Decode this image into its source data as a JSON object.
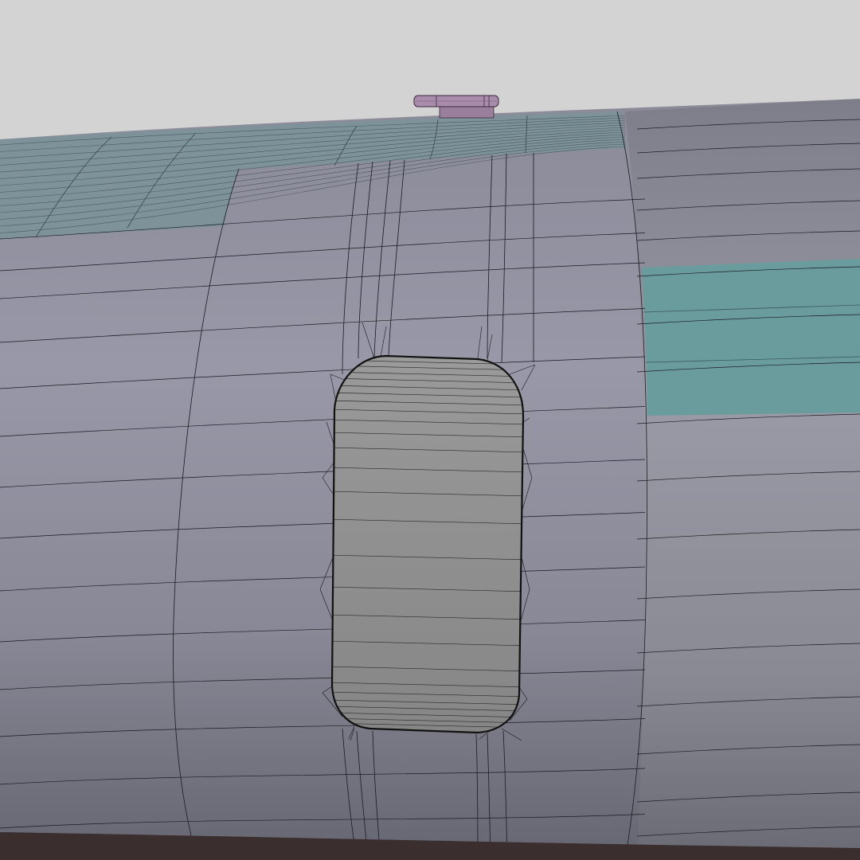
{
  "scene": {
    "background_color": "#d3d3d3",
    "fuselage_color": "#8f8f9e",
    "fuselage_shade_color": "#6e6e7a",
    "top_band_color": "#7d8f96",
    "window_fill_color": "#8a8a8a",
    "window_outline_color": "#111111",
    "highlight_panel_color": "#6a9a9c",
    "antenna_color": "#9a7f9c",
    "bottom_strip_color": "#3a2e2e",
    "wire_color": "#1a1a22"
  }
}
